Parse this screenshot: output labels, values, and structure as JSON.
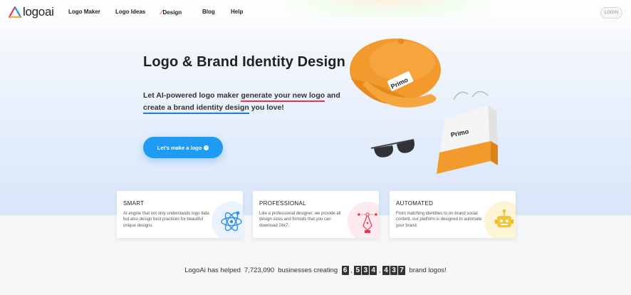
{
  "nav": {
    "brand": "logoai",
    "items": [
      "Logo Maker",
      "Logo Ideas",
      "Design",
      "Blog",
      "Help"
    ],
    "login": "LOGIN"
  },
  "hero": {
    "title": "Logo & Brand Identity Design",
    "sub_lead": "Let AI-powered logo maker ",
    "sub_link1": "generate your new logo",
    "sub_and": " and",
    "sub_link2": "create a brand identity design",
    "sub_tail": " you love!",
    "cta": "Let's make a logo",
    "brand_mark": "Primo"
  },
  "features": [
    {
      "title": "SMART",
      "desc": "AI engine that not only understands logo data but also design best practices for beautiful unique designs.",
      "icon": "atom-icon",
      "color": "#eaf3fe"
    },
    {
      "title": "PROFESSIONAL",
      "desc": "Like a professional designer, we provide all design sizes and formats that you can download 24x7.",
      "icon": "pen-tool-icon",
      "color": "#fdebef"
    },
    {
      "title": "AUTOMATED",
      "desc": "From matching identities to on-brand social content, our platform is designed to automate your brand.",
      "icon": "robot-icon",
      "color": "#fdf6dc"
    }
  ],
  "counter": {
    "prefix": "LogoAi has helped",
    "businesses": "7,723,090",
    "middle": "businesses creating",
    "groups": [
      "6",
      "534",
      "437"
    ],
    "suffix": "brand logos!"
  },
  "colors": {
    "accent": "#1e9cf4",
    "red": "#e8344f",
    "blue": "#1f7fd8"
  }
}
